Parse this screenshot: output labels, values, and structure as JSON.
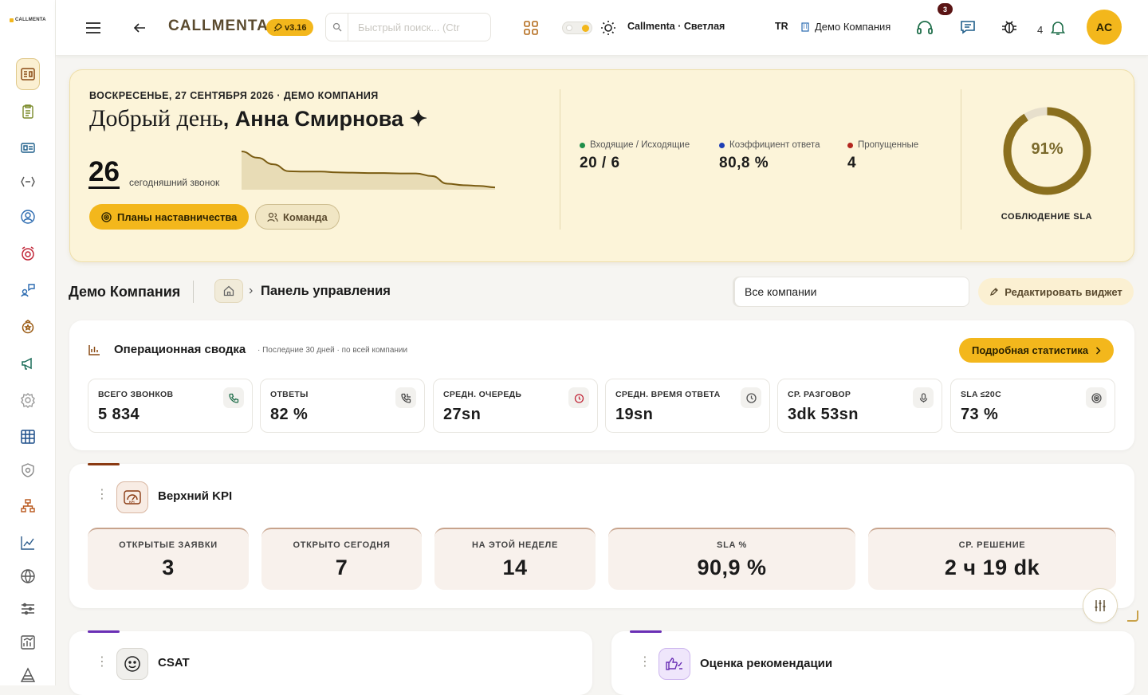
{
  "sidebar": {
    "logo_text": "CALLMENTA",
    "items": [
      "dashboard-icon",
      "clipboard-icon",
      "id-card-icon",
      "api-icon",
      "support-agent-icon",
      "alarm-icon",
      "chat-user-icon",
      "medal-icon",
      "megaphone-icon",
      "settings-gear-icon",
      "grid-report-icon",
      "shield-icon",
      "org-chart-icon",
      "trend-chart-icon",
      "globe-icon",
      "list-sliders-icon",
      "analytics-icon",
      "pyramid-icon"
    ]
  },
  "topbar": {
    "brand": "CALLMENTA",
    "version": "v3.16",
    "search_placeholder": "Быстрый поиск... (Ctr",
    "theme_label": "Callmenta · Светлая",
    "language": "TR",
    "company": "Демо Компания",
    "chat_badge": "3",
    "notifications_count": "4",
    "avatar_initials": "AC"
  },
  "hero": {
    "date_line": "ВОСКРЕСЕНЬЕ, 27 СЕНТЯБРЯ 2026 · ДЕМО КОМПАНИЯ",
    "greeting_prefix": "Добрый день",
    "greeting_name": ", Анна Смирнова ✦",
    "today_calls": "26",
    "today_calls_label": "сегодняшний звонок",
    "sparkline": [
      10,
      8.3,
      6.5,
      4.6,
      4.5,
      4.5,
      4.3,
      4.2,
      4.1,
      4.1,
      4,
      4,
      3.3,
      1.2,
      0.8,
      0.6,
      0.2
    ],
    "mentor_button": "Планы наставничества",
    "team_button": "Команда",
    "kpis": [
      {
        "label": "Входящие / Исходящие",
        "value": "20 / 6",
        "dot": "#1f8f4a"
      },
      {
        "label": "Коэффициент ответа",
        "value": "80,8 %",
        "dot": "#1e3fb5"
      },
      {
        "label": "Пропущенные",
        "value": "4",
        "dot": "#b3261e"
      }
    ],
    "sla_percent": 91,
    "sla_text": "91%",
    "sla_label": "СОБЛЮДЕНИЕ SLA"
  },
  "breadcrumb": {
    "company": "Демо Компания",
    "page": "Панель управления",
    "company_select": "Все компании",
    "edit_widget": "Редактировать виджет"
  },
  "ops": {
    "title": "Операционная сводка",
    "subtitle": "· Последние 30 дней · по всей компании",
    "detail_button": "Подробная статистика",
    "stats": [
      {
        "label": "ВСЕГО ЗВОНКОВ",
        "value": "5 834",
        "icon": "phone-icon"
      },
      {
        "label": "ОТВЕТЫ",
        "value": "82 %",
        "icon": "phone-answer-icon"
      },
      {
        "label": "СРЕДН. ОЧЕРЕДЬ",
        "value": "27sn",
        "icon": "timer-icon"
      },
      {
        "label": "СРЕДН. ВРЕМЯ ОТВЕТА",
        "value": "19sn",
        "icon": "clock-icon"
      },
      {
        "label": "СР. РАЗГОВОР",
        "value": "3dk 53sn",
        "icon": "microphone-icon"
      },
      {
        "label": "SLA ≤20C",
        "value": "73 %",
        "icon": "target-icon"
      }
    ]
  },
  "kpi_widget": {
    "title": "Верхний KPI",
    "accent": "#8a3a12",
    "boxes": [
      {
        "label": "ОТКРЫТЫЕ ЗАЯВКИ",
        "value": "3"
      },
      {
        "label": "ОТКРЫТО СЕГОДНЯ",
        "value": "7"
      },
      {
        "label": "НА ЭТОЙ НЕДЕЛЕ",
        "value": "14"
      },
      {
        "label": "SLA %",
        "value": "90,9 %"
      },
      {
        "label": "СР. РЕШЕНИЕ",
        "value": "2 ч 19 dk"
      }
    ]
  },
  "csat_widget": {
    "title": "CSAT",
    "accent": "#6a2fb5"
  },
  "recommend_widget": {
    "title": "Оценка рекомендации",
    "accent": "#6a2fb5"
  },
  "colors": {
    "brand": "#f3b71c",
    "hero_bg": "#fcf4d9",
    "gauge": "#8a6f1e"
  }
}
